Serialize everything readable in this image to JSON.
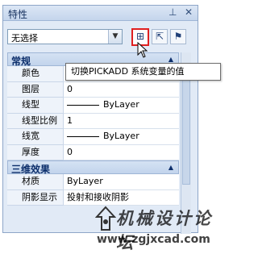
{
  "palette": {
    "title": "特性",
    "pin_icon": "pin-icon",
    "close_icon": "close-icon"
  },
  "toolbar": {
    "selection_value": "无选择",
    "pickadd_icon": "pickadd-icon",
    "select_objects_icon": "select-objects-icon",
    "quick_select_icon": "quick-select-icon"
  },
  "tooltip": "切换PICKADD 系统变量的值",
  "sections": {
    "general": {
      "title": "常规",
      "rows": [
        {
          "name": "颜色",
          "value": ""
        },
        {
          "name": "图层",
          "value": "0"
        },
        {
          "name": "线型",
          "value": "ByLayer"
        },
        {
          "name": "线型比例",
          "value": "1"
        },
        {
          "name": "线宽",
          "value": "ByLayer"
        },
        {
          "name": "厚度",
          "value": "0"
        }
      ]
    },
    "threed": {
      "title": "三维效果",
      "rows": [
        {
          "name": "材质",
          "value": "ByLayer"
        },
        {
          "name": "阴影显示",
          "value": "投射和接收阴影"
        }
      ]
    }
  },
  "watermark": {
    "text": "机械设计论坛",
    "url": "www.zgjxcad.com"
  }
}
